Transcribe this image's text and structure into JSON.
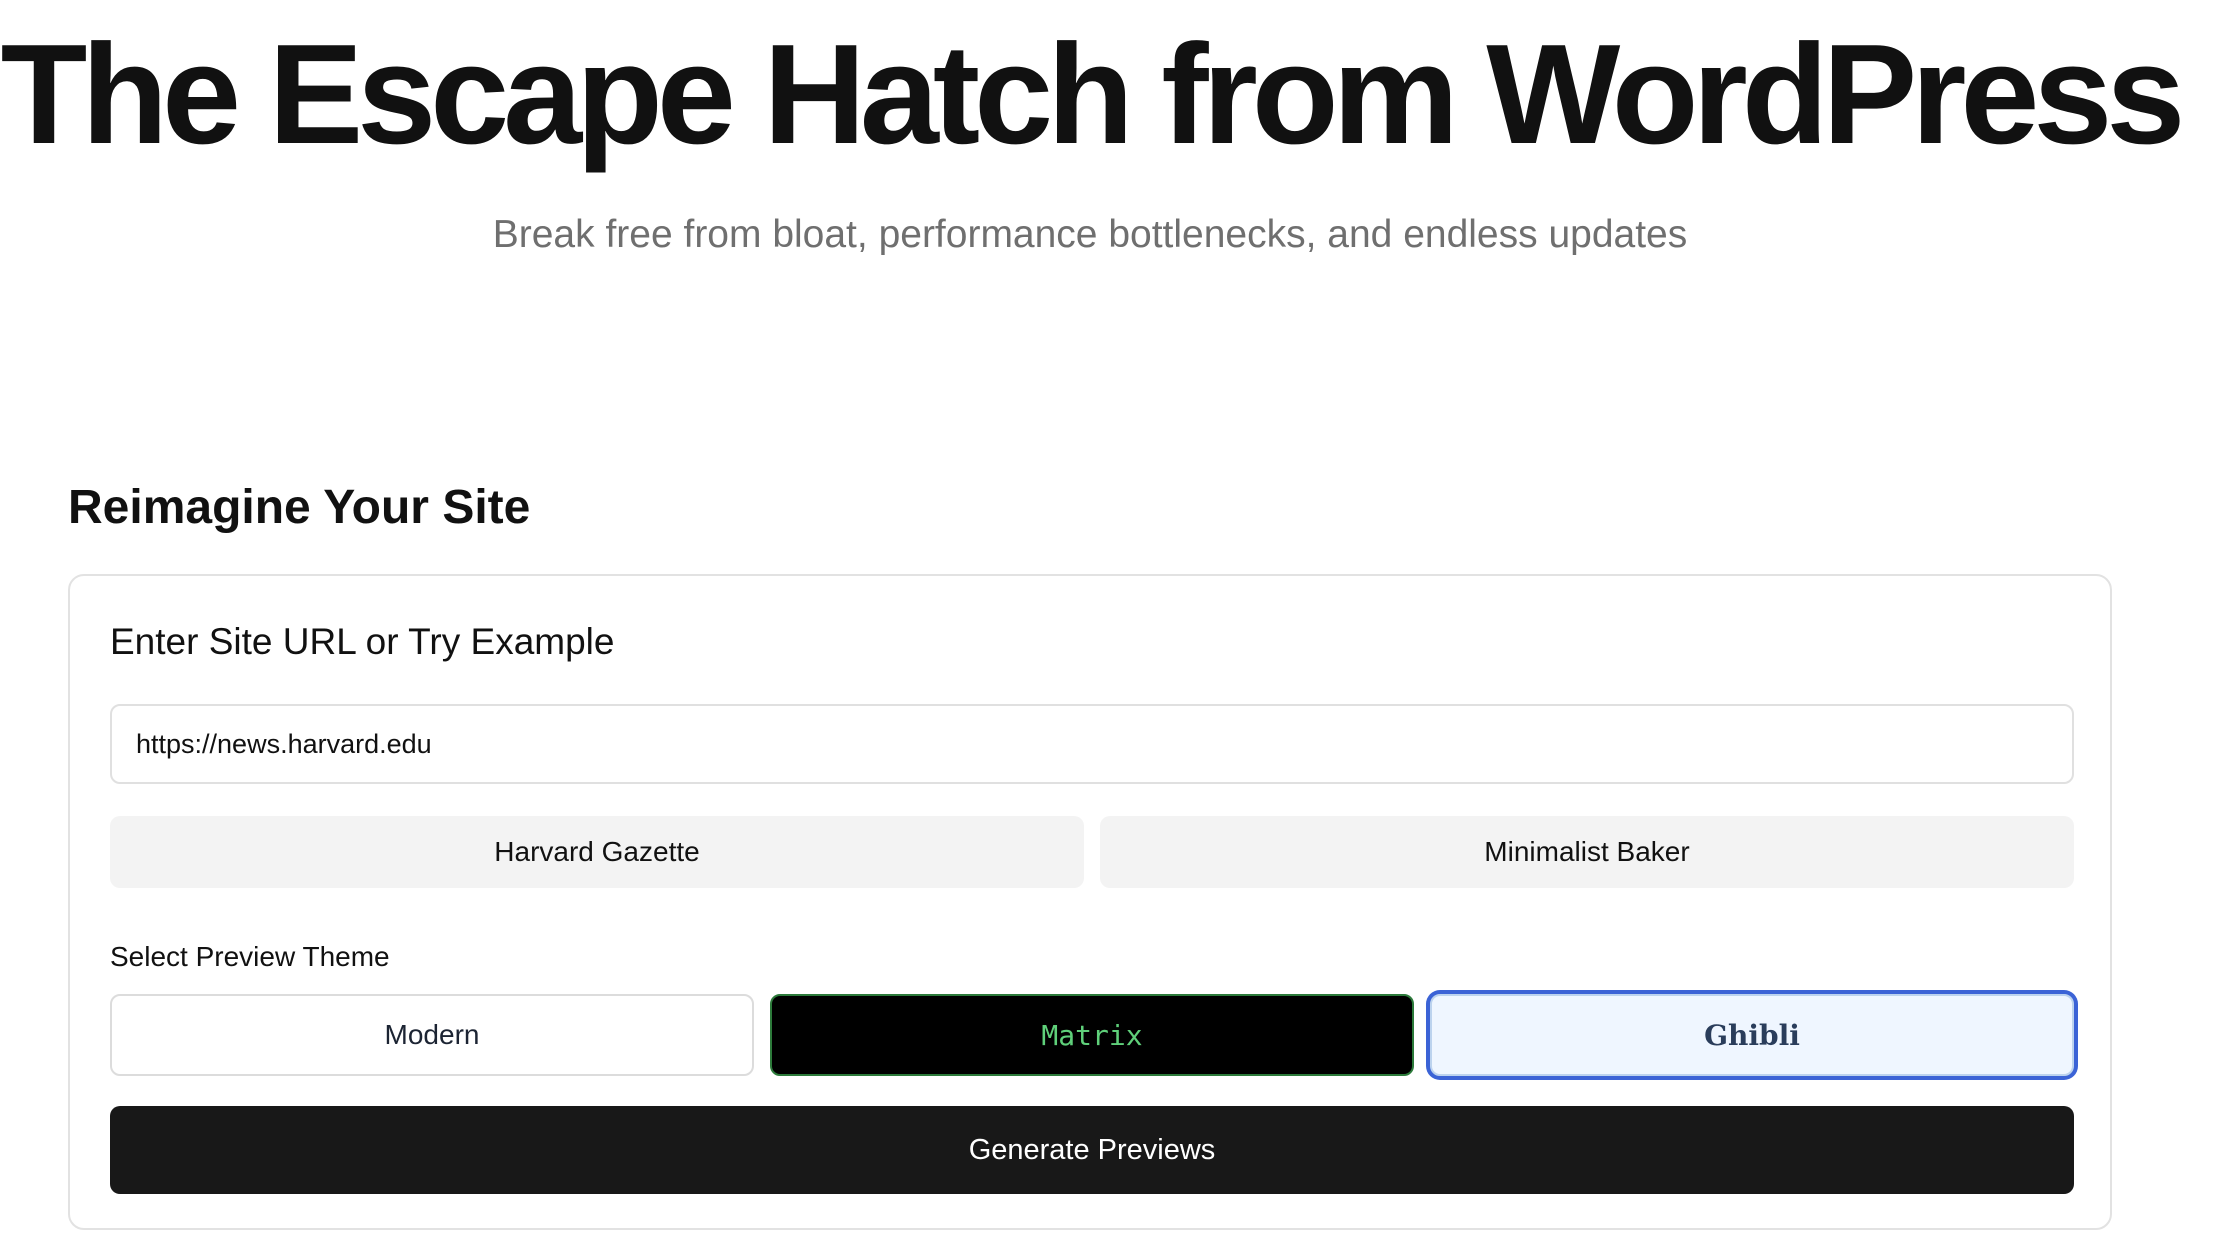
{
  "hero": {
    "title": "The Escape Hatch from WordPress",
    "subtitle": "Break free from bloat, performance bottlenecks, and endless updates"
  },
  "section": {
    "heading": "Reimagine Your Site"
  },
  "form": {
    "url_label": "Enter Site URL or Try Example",
    "url_value": "https://news.harvard.edu",
    "examples": [
      {
        "label": "Harvard Gazette"
      },
      {
        "label": "Minimalist Baker"
      }
    ],
    "theme_label": "Select Preview Theme",
    "themes": [
      {
        "label": "Modern"
      },
      {
        "label": "Matrix"
      },
      {
        "label": "Ghibli"
      }
    ],
    "selected_theme": "Ghibli",
    "generate_label": "Generate Previews"
  },
  "colors": {
    "primary_button": "#181818",
    "matrix_text": "#5fd07a",
    "selected_ring": "#3b63d6",
    "subtitle_text": "#6f6f6f"
  }
}
